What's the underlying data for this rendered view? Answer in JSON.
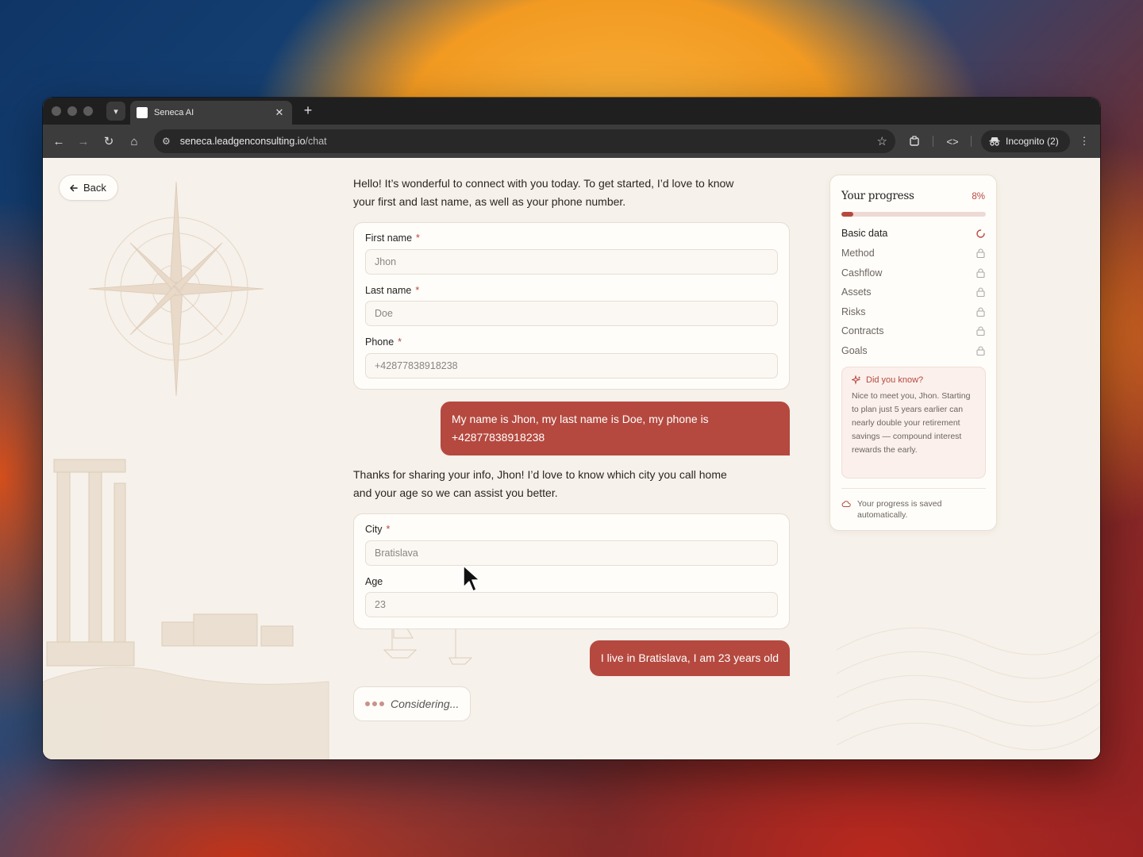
{
  "browser": {
    "tab_title": "Seneca AI",
    "new_tab_label": "+",
    "url_host": "seneca.leadgenconsulting.io",
    "url_path": "/chat",
    "incognito_label": "Incognito (2)"
  },
  "page": {
    "back_label": "Back",
    "messages": {
      "ai_1": "Hello! It’s wonderful to connect with you today. To get started, I’d love to know your first and last name, as well as your phone number.",
      "user_1": "My name is Jhon, my last name is Doe, my phone is +42877838918238",
      "ai_2": "Thanks for sharing your info, Jhon! I’d love to know which city you call home and your age so we can assist you better.",
      "user_2": "I live in Bratislava, I am 23 years old",
      "thinking": "Considering..."
    },
    "form1": {
      "first_name_label": "First name",
      "first_name_value": "Jhon",
      "last_name_label": "Last name",
      "last_name_value": "Doe",
      "phone_label": "Phone",
      "phone_value": "+42877838918238",
      "required_mark": "*"
    },
    "form2": {
      "city_label": "City",
      "city_value": "Bratislava",
      "age_label": "Age",
      "age_value": "23",
      "required_mark": "*"
    }
  },
  "progress": {
    "title": "Your progress",
    "percent_label": "8%",
    "percent_value": 8,
    "steps": [
      {
        "label": "Basic data",
        "status": "in-progress"
      },
      {
        "label": "Method",
        "status": "locked"
      },
      {
        "label": "Cashflow",
        "status": "locked"
      },
      {
        "label": "Assets",
        "status": "locked"
      },
      {
        "label": "Risks",
        "status": "locked"
      },
      {
        "label": "Contracts",
        "status": "locked"
      },
      {
        "label": "Goals",
        "status": "locked"
      }
    ],
    "tip_title": "Did you know?",
    "tip_body": "Nice to meet you, Jhon. Starting to plan just 5 years earlier can nearly double your retirement savings — compound interest rewards the early.",
    "saved_text": "Your progress is saved automatically."
  },
  "colors": {
    "accent": "#b5493f",
    "page_bg": "#f6f1ea"
  }
}
